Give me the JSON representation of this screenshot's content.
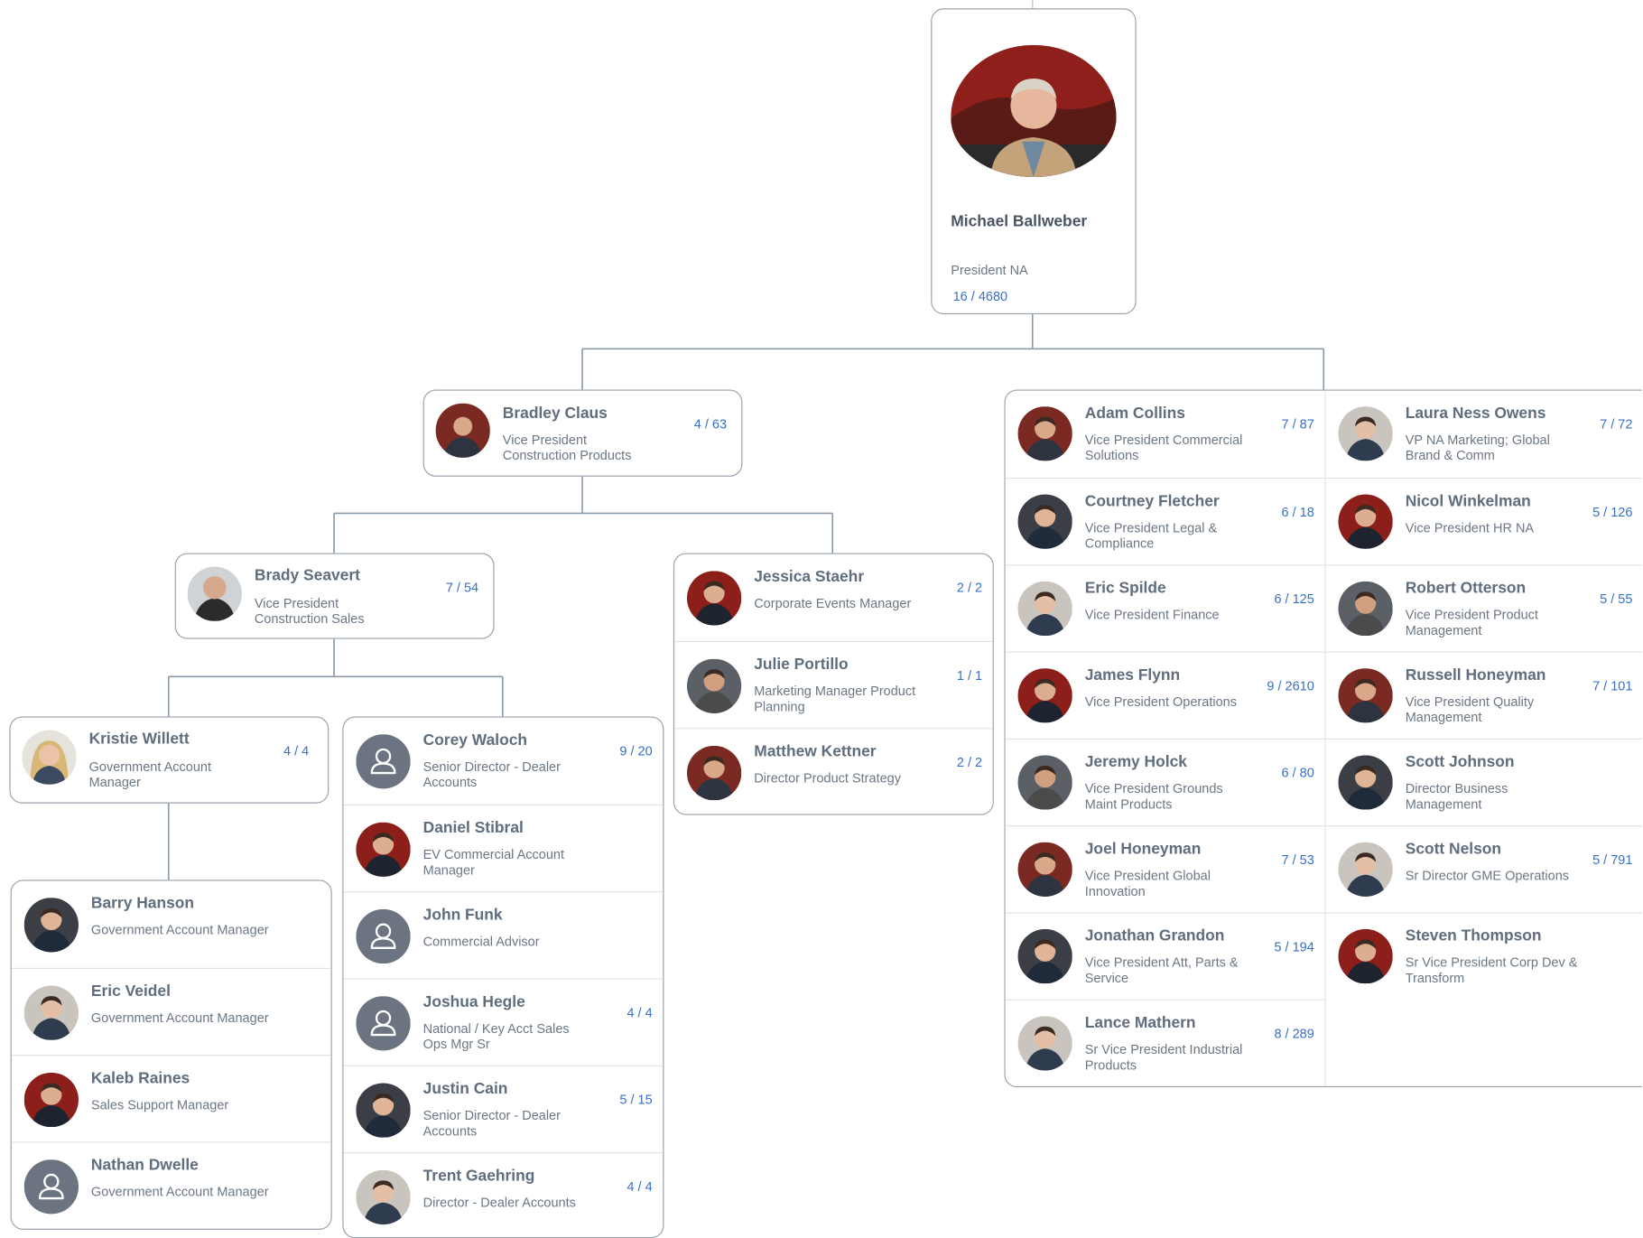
{
  "root": {
    "name": "Michael Ballweber",
    "title": "President NA",
    "count": "16 / 4680"
  },
  "bradley": {
    "name": "Bradley Claus",
    "title": "Vice President Construction Products",
    "count": "4 / 63"
  },
  "brady": {
    "name": "Brady Seavert",
    "title": "Vice President Construction Sales",
    "count": "7 / 54"
  },
  "kristie": {
    "name": "Kristie Willett",
    "title": "Government Account Manager",
    "count": "4 / 4"
  },
  "kristie_reports": [
    {
      "name": "Barry Hanson",
      "title": "Government Account Manager",
      "count": ""
    },
    {
      "name": "Eric Veidel",
      "title": "Government Account Manager",
      "count": ""
    },
    {
      "name": "Kaleb Raines",
      "title": "Sales Support Manager",
      "count": ""
    },
    {
      "name": "Nathan Dwelle",
      "title": "Government Account Manager",
      "count": ""
    }
  ],
  "brady_reports": [
    {
      "name": "Corey Waloch",
      "title": "Senior Director - Dealer Accounts",
      "count": "9 / 20"
    },
    {
      "name": "Daniel Stibral",
      "title": "EV Commercial Account Manager",
      "count": ""
    },
    {
      "name": "John Funk",
      "title": "Commercial Advisor",
      "count": ""
    },
    {
      "name": "Joshua Hegle",
      "title": "National / Key Acct Sales Ops Mgr Sr",
      "count": "4 / 4"
    },
    {
      "name": "Justin Cain",
      "title": "Senior Director - Dealer Accounts",
      "count": "5 / 15"
    },
    {
      "name": "Trent Gaehring",
      "title": "Director - Dealer Accounts",
      "count": "4 / 4"
    }
  ],
  "bradley_reports": [
    {
      "name": "Jessica Staehr",
      "title": "Corporate Events Manager",
      "count": "2 / 2"
    },
    {
      "name": "Julie Portillo",
      "title": "Marketing Manager Product Planning",
      "count": "1 / 1"
    },
    {
      "name": "Matthew Kettner",
      "title": "Director Product Strategy",
      "count": "2 / 2"
    }
  ],
  "vp_left": [
    {
      "name": "Adam Collins",
      "title": "Vice President Commercial Solutions",
      "count": "7 / 87"
    },
    {
      "name": "Courtney Fletcher",
      "title": "Vice President Legal & Compliance",
      "count": "6 / 18"
    },
    {
      "name": "Eric Spilde",
      "title": "Vice President Finance",
      "count": "6 / 125"
    },
    {
      "name": "James Flynn",
      "title": "Vice President Operations",
      "count": "9 / 2610"
    },
    {
      "name": "Jeremy Holck",
      "title": "Vice President Grounds Maint Products",
      "count": "6 / 80"
    },
    {
      "name": "Joel Honeyman",
      "title": "Vice President Global Innovation",
      "count": "7 / 53"
    },
    {
      "name": "Jonathan Grandon",
      "title": "Vice President Att, Parts & Service",
      "count": "5 / 194"
    },
    {
      "name": "Lance Mathern",
      "title": "Sr Vice President Industrial Products",
      "count": "8 / 289"
    }
  ],
  "vp_right": [
    {
      "name": "Laura Ness Owens",
      "title": "VP NA Marketing; Global Brand & Comm",
      "count": "7 / 72"
    },
    {
      "name": "Nicol Winkelman",
      "title": "Vice President HR NA",
      "count": "5 / 126"
    },
    {
      "name": "Robert Otterson",
      "title": "Vice President Product Management",
      "count": "5 / 55"
    },
    {
      "name": "Russell Honeyman",
      "title": "Vice President Quality Management",
      "count": "7 / 101"
    },
    {
      "name": "Scott Johnson",
      "title": "Director Business Management",
      "count": ""
    },
    {
      "name": "Scott Nelson",
      "title": "Sr Director GME Operations",
      "count": "5 / 791"
    },
    {
      "name": "Steven Thompson",
      "title": "Sr Vice President Corp Dev & Transform",
      "count": ""
    }
  ],
  "colors": {
    "link": "#3670c9",
    "line": "#8a9aab",
    "border": "#97a1ab",
    "name": "#5f6d7d"
  }
}
